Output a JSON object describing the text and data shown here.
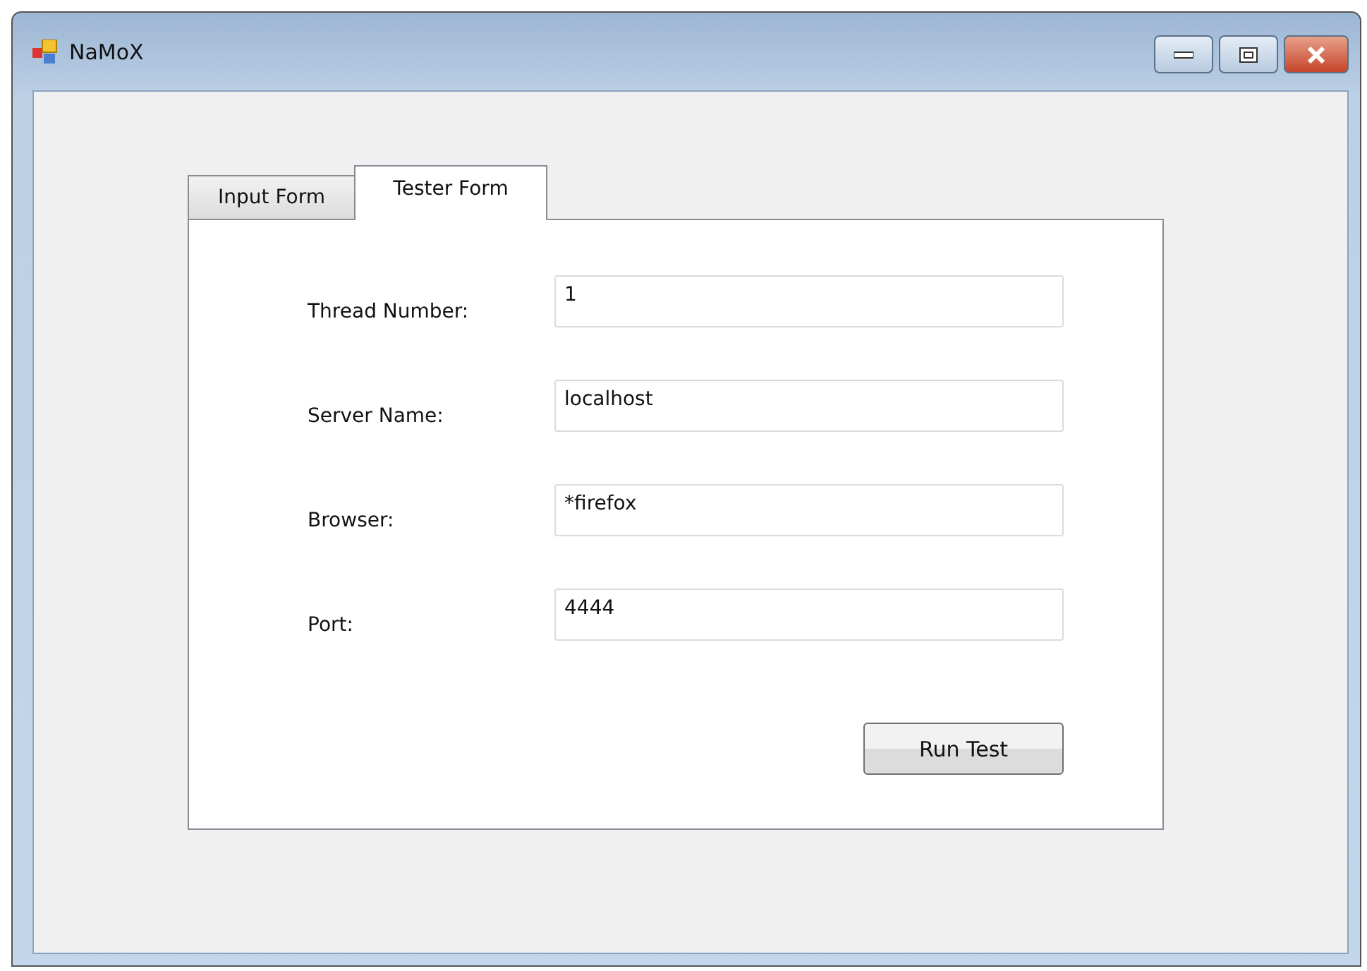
{
  "window": {
    "title": "NaMoX"
  },
  "tabs": [
    {
      "label": "Input Form",
      "selected": false
    },
    {
      "label": "Tester Form",
      "selected": true
    }
  ],
  "fields": [
    {
      "label": "Thread Number:",
      "value": "1"
    },
    {
      "label": "Server Name:",
      "value": "localhost"
    },
    {
      "label": "Browser:",
      "value": "*firefox"
    },
    {
      "label": "Port:",
      "value": "4444"
    }
  ],
  "button": "Run Test"
}
